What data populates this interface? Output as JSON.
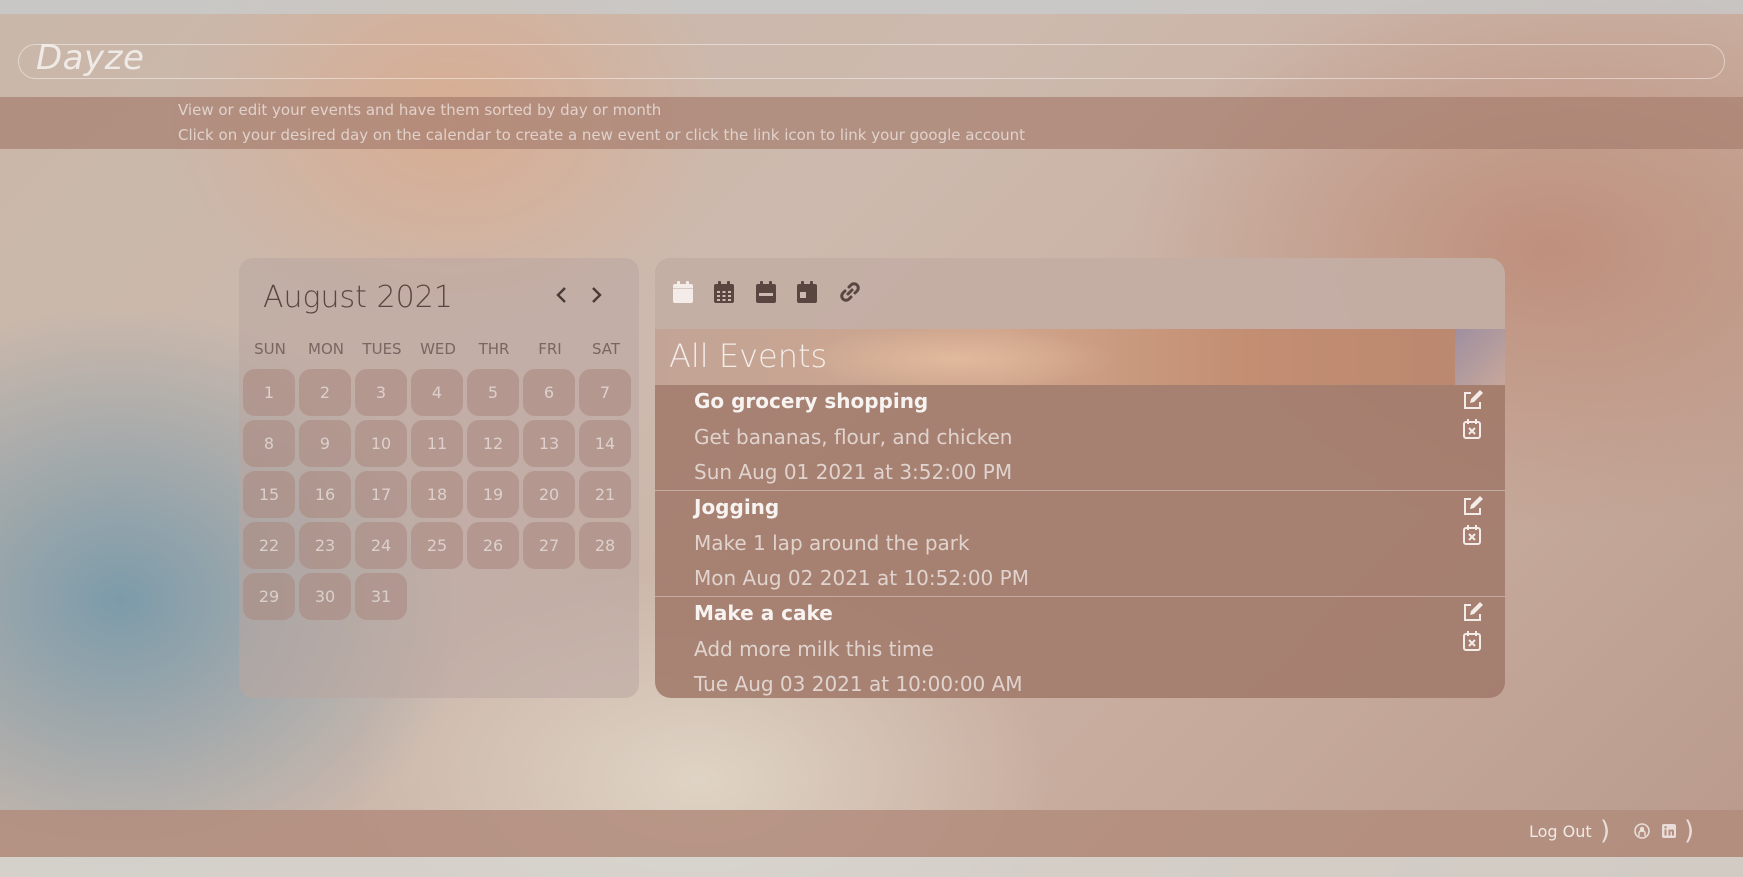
{
  "app": {
    "logo": "Dayze"
  },
  "info": {
    "line1": "View or edit your events and have them sorted by day or month",
    "line2": "Click on your desired day on the calendar to create a new event or click the link icon to link your google account"
  },
  "calendar": {
    "month_label": "August 2021",
    "weekdays": [
      "SUN",
      "MON",
      "TUES",
      "WED",
      "THR",
      "FRI",
      "SAT"
    ],
    "days": [
      "1",
      "2",
      "3",
      "4",
      "5",
      "6",
      "7",
      "8",
      "9",
      "10",
      "11",
      "12",
      "13",
      "14",
      "15",
      "16",
      "17",
      "18",
      "19",
      "20",
      "21",
      "22",
      "23",
      "24",
      "25",
      "26",
      "27",
      "28",
      "29",
      "30",
      "31"
    ],
    "prev_icon": "chevron-left-icon",
    "next_icon": "chevron-right-icon"
  },
  "toolbar": {
    "icons": [
      "calendar-blank-icon",
      "calendar-month-icon",
      "calendar-week-icon",
      "calendar-day-icon",
      "link-icon"
    ]
  },
  "events": {
    "heading": "All Events",
    "items": [
      {
        "title": "Go grocery shopping",
        "description": "Get bananas, flour, and chicken",
        "date": "Sun Aug 01 2021 at 3:52:00 PM"
      },
      {
        "title": "Jogging",
        "description": "Make 1 lap around the park",
        "date": "Mon Aug 02 2021 at 10:52:00 PM"
      },
      {
        "title": "Make a cake",
        "description": "Add more milk this time",
        "date": "Tue Aug 03 2021 at 10:00:00 AM"
      }
    ]
  },
  "footer": {
    "logout_label": "Log Out",
    "icons": [
      "github-icon",
      "linkedin-icon"
    ]
  },
  "colors": {
    "accent": "#4a3a35",
    "band": "#a88070",
    "panel": "#a07869"
  }
}
